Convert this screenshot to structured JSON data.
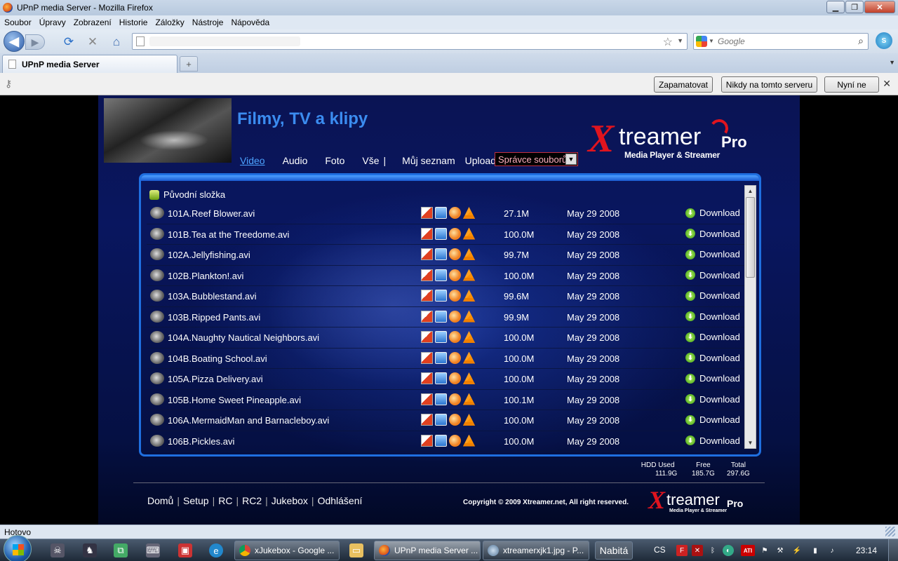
{
  "window": {
    "title": "UPnP media Server - Mozilla Firefox"
  },
  "menu": [
    "Soubor",
    "Úpravy",
    "Zobrazení",
    "Historie",
    "Záložky",
    "Nástroje",
    "Nápověda"
  ],
  "search": {
    "placeholder": "Google"
  },
  "tab": {
    "label": "UPnP media Server",
    "new_tab": "+"
  },
  "notification": {
    "remember": "Zapamatovat",
    "never": "Nikdy na tomto serveru",
    "not_now": "Nyní ne"
  },
  "page": {
    "heading": "Filmy, TV a klipy",
    "nav": [
      "Video",
      "Audio",
      "Foto",
      "Vše",
      "Můj seznam",
      "Upload"
    ],
    "nav_sep": "|",
    "select_value": "Správce souborů",
    "brand": {
      "x": "X",
      "rest": "treamer",
      "pro": "Pro",
      "tagline": "Media Player & Streamer"
    },
    "parent_folder": "Původní složka",
    "download_label": "Download",
    "files": [
      {
        "name": "101A.Reef Blower.avi",
        "size": "27.1M",
        "date": "May 29 2008"
      },
      {
        "name": "101B.Tea at the Treedome.avi",
        "size": "100.0M",
        "date": "May 29 2008"
      },
      {
        "name": "102A.Jellyfishing.avi",
        "size": "99.7M",
        "date": "May 29 2008"
      },
      {
        "name": "102B.Plankton!.avi",
        "size": "100.0M",
        "date": "May 29 2008"
      },
      {
        "name": "103A.Bubblestand.avi",
        "size": "99.6M",
        "date": "May 29 2008"
      },
      {
        "name": "103B.Ripped Pants.avi",
        "size": "99.9M",
        "date": "May 29 2008"
      },
      {
        "name": "104A.Naughty Nautical Neighbors.avi",
        "size": "100.0M",
        "date": "May 29 2008"
      },
      {
        "name": "104B.Boating School.avi",
        "size": "100.0M",
        "date": "May 29 2008"
      },
      {
        "name": "105A.Pizza Delivery.avi",
        "size": "100.0M",
        "date": "May 29 2008"
      },
      {
        "name": "105B.Home Sweet Pineapple.avi",
        "size": "100.1M",
        "date": "May 29 2008"
      },
      {
        "name": "106A.MermaidMan and Barnacleboy.avi",
        "size": "100.0M",
        "date": "May 29 2008"
      },
      {
        "name": "106B.Pickles.avi",
        "size": "100.0M",
        "date": "May 29 2008"
      }
    ],
    "hdd": {
      "used_label": "HDD Used",
      "used": "111.9G",
      "free_label": "Free",
      "free": "185.7G",
      "total_label": "Total",
      "total": "297.6G"
    },
    "footer_links": [
      "Domů",
      "Setup",
      "RC",
      "RC2",
      "Jukebox",
      "Odhlášení"
    ],
    "footer_sep": "|",
    "copyright": "Copyright © 2009 Xtreamer.net, All right reserved."
  },
  "status": {
    "text": "Hotovo"
  },
  "taskbar": {
    "windows": [
      {
        "label": "xJukebox - Google ..."
      },
      {
        "label": "UPnP media Server ..."
      },
      {
        "label": "xtreamerxjk1.jpg - P..."
      }
    ],
    "nabita": "Nabitá",
    "lang": "CS",
    "time": "23:14"
  },
  "colors": {
    "accent": "#3b8cf0",
    "panel_border": "#1f6fe0",
    "brand_red": "#e0141e"
  }
}
